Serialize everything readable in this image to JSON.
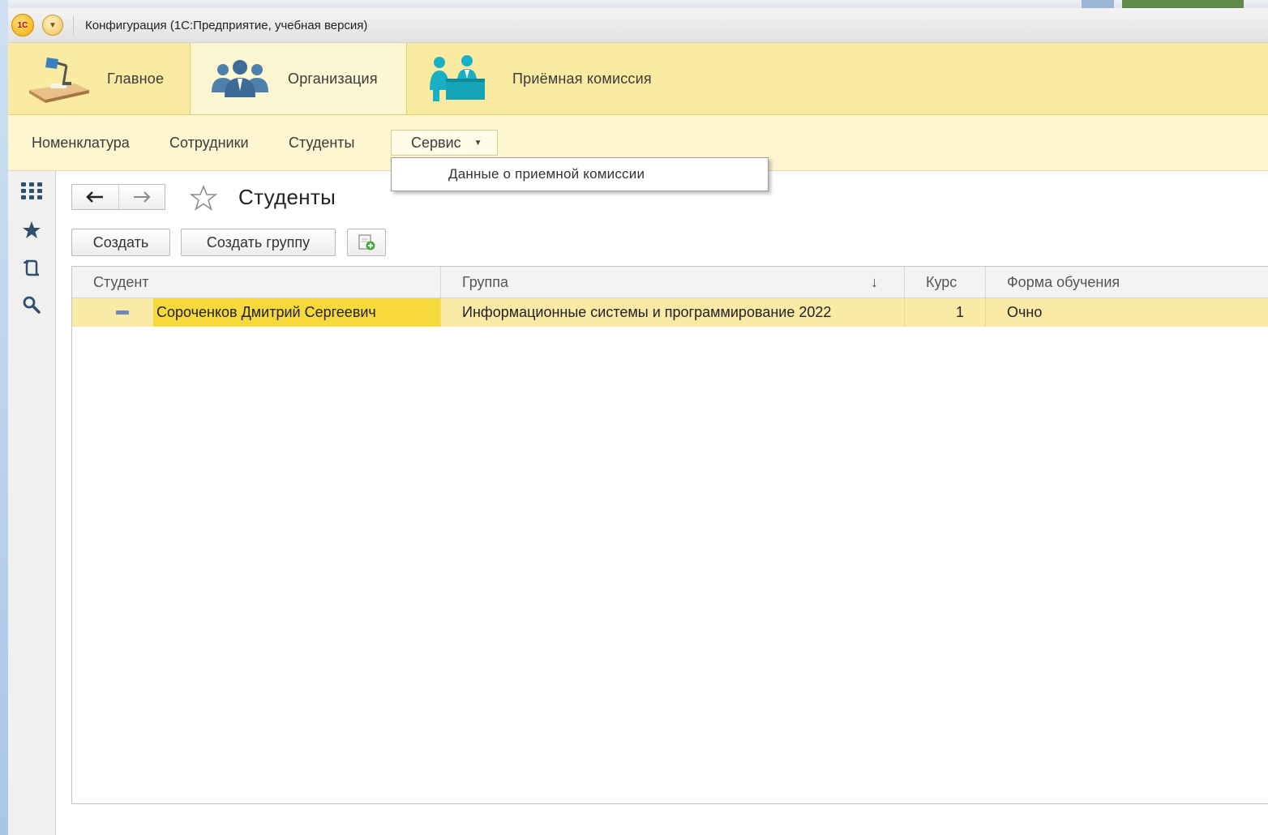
{
  "window": {
    "title": "Конфигурация  (1С:Предприятие, учебная версия)"
  },
  "sections": [
    {
      "label": "Главное",
      "icon": "desk-lamp-icon"
    },
    {
      "label": "Организация",
      "icon": "people-group-icon",
      "active": true
    },
    {
      "label": "Приёмная комиссия",
      "icon": "reception-desk-icon"
    }
  ],
  "commands": {
    "items": [
      "Номенклатура",
      "Сотрудники",
      "Студенты"
    ],
    "service_label": "Сервис",
    "dropdown_item": "Данные о приемной комиссии"
  },
  "page": {
    "title": "Студенты"
  },
  "toolbar": {
    "create_label": "Создать",
    "create_group_label": "Создать группу"
  },
  "table": {
    "columns": [
      "Студент",
      "Группа",
      "Курс",
      "Форма обучения"
    ],
    "sort_indicator": "↓",
    "rows": [
      {
        "student": "Сороченков Дмитрий Сергеевич",
        "group": "Информационные системы и программирование 2022",
        "course": "1",
        "form": "Очно"
      }
    ]
  },
  "colors": {
    "section_bar": "#fbeba2",
    "command_bar": "#fdf6d0",
    "selected_row": "#fbe9a6",
    "selected_cell": "#f8d93c"
  }
}
